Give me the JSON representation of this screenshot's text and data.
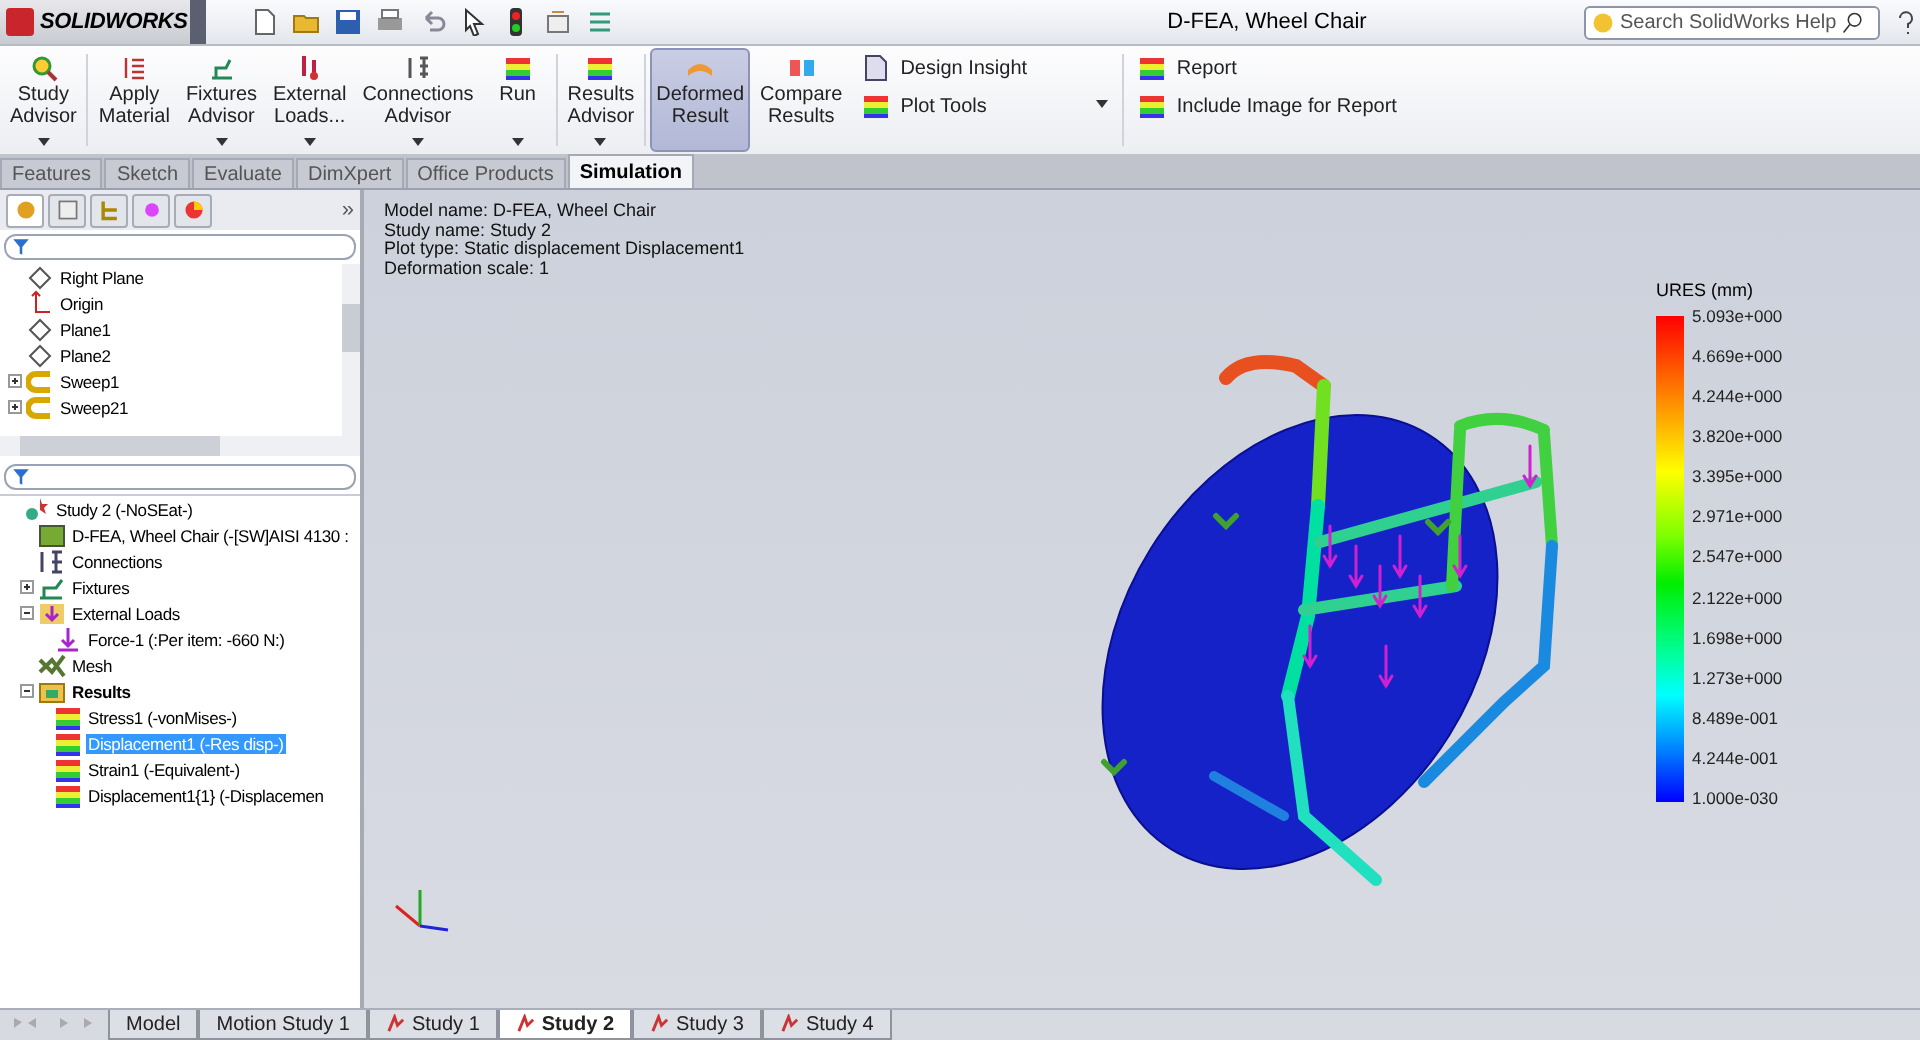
{
  "app": {
    "logo": "SOLIDWORKS",
    "title": "D-FEA, Wheel Chair",
    "search": {
      "placeholder": "Search SolidWorks Help"
    }
  },
  "ribbon": {
    "buttons": [
      {
        "lines": [
          "Study",
          "Advisor"
        ],
        "selected": false,
        "dropdown": true
      },
      {
        "lines": [
          "Apply",
          "Material"
        ],
        "selected": false,
        "dropdown": false
      },
      {
        "lines": [
          "Fixtures",
          "Advisor"
        ],
        "selected": false,
        "dropdown": true
      },
      {
        "lines": [
          "External",
          "Loads..."
        ],
        "selected": false,
        "dropdown": true
      },
      {
        "lines": [
          "Connections",
          "Advisor"
        ],
        "selected": false,
        "dropdown": true
      },
      {
        "lines": [
          "Run"
        ],
        "selected": false,
        "dropdown": true
      },
      {
        "lines": [
          "Results",
          "Advisor"
        ],
        "selected": false,
        "dropdown": true
      },
      {
        "lines": [
          "Deformed",
          "Result"
        ],
        "selected": true,
        "dropdown": false
      },
      {
        "lines": [
          "Compare",
          "Results"
        ],
        "selected": false,
        "dropdown": false
      }
    ],
    "small_buttons": [
      {
        "label": "Design Insight",
        "dropdown": false
      },
      {
        "label": "Plot Tools",
        "dropdown": true
      }
    ],
    "report_buttons": [
      {
        "label": "Report"
      },
      {
        "label": "Include Image for Report"
      }
    ]
  },
  "command_tabs": [
    {
      "label": "Features",
      "selected": false
    },
    {
      "label": "Sketch",
      "selected": false
    },
    {
      "label": "Evaluate",
      "selected": false
    },
    {
      "label": "DimXpert",
      "selected": false
    },
    {
      "label": "Office Products",
      "selected": false
    },
    {
      "label": "Simulation",
      "selected": true
    }
  ],
  "panel_tabs_more": "»",
  "feature_tree": [
    {
      "kind": "plane",
      "label": "Right Plane"
    },
    {
      "kind": "origin",
      "label": "Origin"
    },
    {
      "kind": "plane",
      "label": "Plane1"
    },
    {
      "kind": "plane",
      "label": "Plane2"
    },
    {
      "kind": "sweep",
      "label": "Sweep1",
      "expanded": false
    },
    {
      "kind": "sweep",
      "label": "Sweep21",
      "expanded": false
    }
  ],
  "study_tree": {
    "kind": "study",
    "label": "Study 2 (-NoSEat-)",
    "children": [
      {
        "kind": "part",
        "label": "D-FEA, Wheel Chair (-[SW]AISI 4130 :"
      },
      {
        "kind": "connections",
        "label": "Connections"
      },
      {
        "kind": "fixtures",
        "label": "Fixtures",
        "expanded": false
      },
      {
        "kind": "loads",
        "label": "External Loads",
        "expanded": true,
        "children": [
          {
            "kind": "force",
            "label": "Force-1 (:Per item: -660 N:)"
          }
        ]
      },
      {
        "kind": "mesh",
        "label": "Mesh"
      },
      {
        "kind": "folder",
        "label": "Results",
        "bold": true,
        "expanded": true,
        "children": [
          {
            "kind": "result",
            "label": "Stress1 (-vonMises-)",
            "selected": false
          },
          {
            "kind": "result",
            "label": "Displacement1 (-Res disp-)",
            "selected": true
          },
          {
            "kind": "result",
            "label": "Strain1 (-Equivalent-)",
            "selected": false
          },
          {
            "kind": "result",
            "label": "Displacement1{1} (-Displacemen",
            "selected": false
          }
        ]
      }
    ]
  },
  "plot_info": [
    "Model name: D-FEA, Wheel Chair",
    "Study name: Study 2",
    "Plot type: Static displacement Displacement1",
    "Deformation scale: 1"
  ],
  "legend": {
    "title": "URES (mm)",
    "labels": [
      "5.093e+000",
      "4.669e+000",
      "4.244e+000",
      "3.820e+000",
      "3.395e+000",
      "2.971e+000",
      "2.547e+000",
      "2.122e+000",
      "1.698e+000",
      "1.273e+000",
      "8.489e-001",
      "4.244e-001",
      "1.000e-030"
    ]
  },
  "bottom_tabs": [
    {
      "label": "Model",
      "kind": "plain",
      "selected": false
    },
    {
      "label": "Motion Study 1",
      "kind": "plain",
      "selected": false
    },
    {
      "label": "Study 1",
      "kind": "study",
      "selected": false
    },
    {
      "label": "Study 2",
      "kind": "study",
      "selected": true
    },
    {
      "label": "Study 3",
      "kind": "study",
      "selected": false
    },
    {
      "label": "Study 4",
      "kind": "study",
      "selected": false
    }
  ]
}
